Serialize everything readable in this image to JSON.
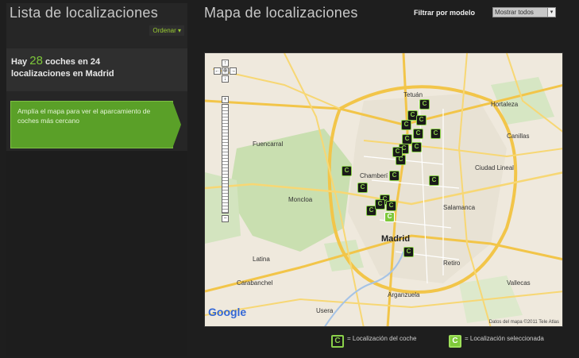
{
  "left_panel": {
    "title": "Lista de localizaciones",
    "order_link": "Ordenar ▾",
    "summary_prefix": "Hay",
    "car_count": "28",
    "summary_rest": "coches en 24",
    "summary_line2": "localizaciones en Madrid",
    "hint_text": "Amplía el mapa para ver el aparcamiento de coches más cercano"
  },
  "right_panel": {
    "title": "Mapa de localizaciones",
    "filter_label": "Filtrar por modelo",
    "filter_value": "Mostrar todos"
  },
  "map": {
    "city_label": "Madrid",
    "labels": [
      "Tetuán",
      "Fuencarral",
      "Ciudad Lineal",
      "Salamanca",
      "Chamberí",
      "Moncloa",
      "Carabanchel",
      "Latina",
      "Retiro",
      "Arganzuela",
      "Usera",
      "Vallecas",
      "Hortaleza",
      "Canillas"
    ],
    "google": "Google",
    "copyright": "Datos del mapa ©2011 Tele Atlas",
    "zoom_in": "+",
    "zoom_out": "−",
    "pan_up": "↑",
    "pan_left": "←",
    "pan_center": "⊕",
    "pan_right": "→",
    "pan_down": "↓",
    "marker_glyph": "C",
    "marker_count": 24,
    "selected_count": 1
  },
  "legend": {
    "car_location": "= Localización del coche",
    "selected_location": "= Localización seleccionada",
    "icon_glyph": "C"
  },
  "colors": {
    "accent_green": "#7ec83a",
    "panel_dark": "#262626",
    "hint_green": "#5aa028"
  }
}
